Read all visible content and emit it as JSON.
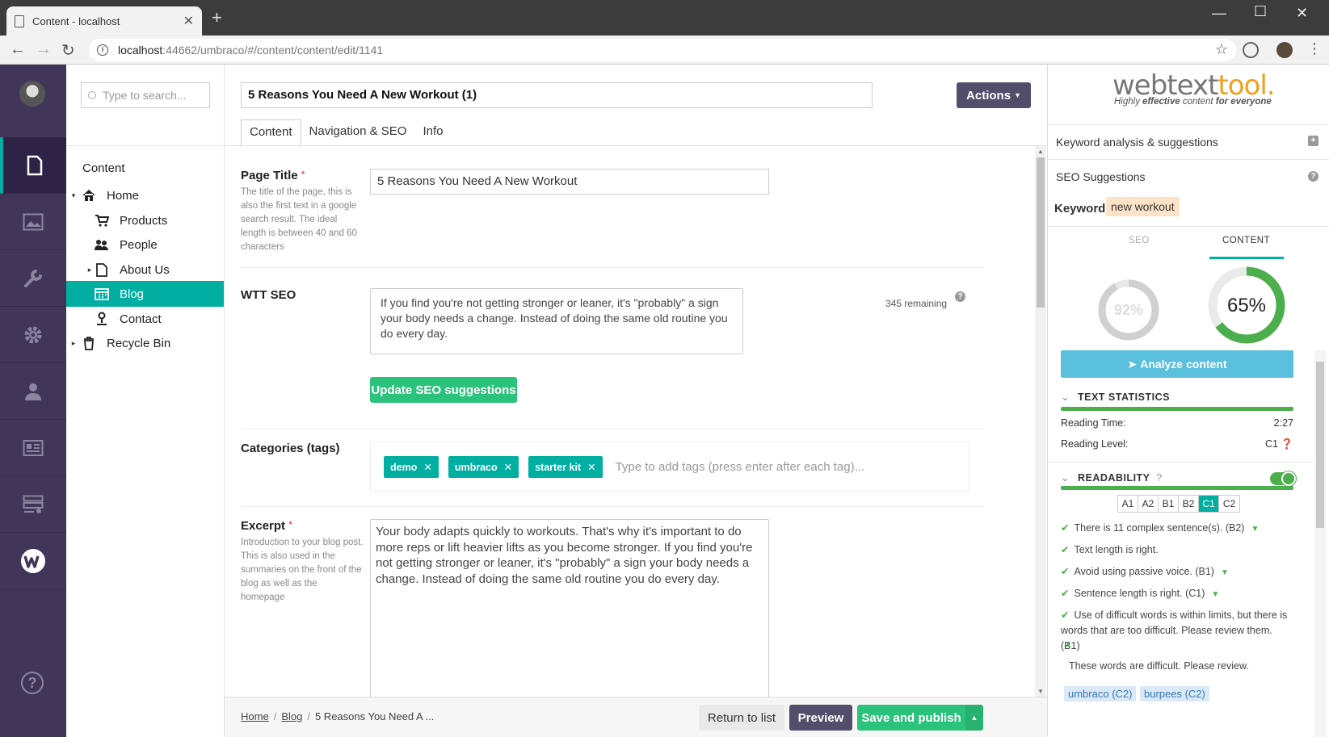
{
  "browser": {
    "tab_title": "Content - localhost",
    "url_host": "localhost",
    "url_path": ":44662/umbraco/#/content/content/edit/1141"
  },
  "rail": {
    "items": [
      {
        "name": "content",
        "icon": "document-icon",
        "active": true
      },
      {
        "name": "media",
        "icon": "image-icon"
      },
      {
        "name": "settings",
        "icon": "wrench-icon"
      },
      {
        "name": "developer",
        "icon": "gear-icon"
      },
      {
        "name": "users",
        "icon": "user-icon"
      },
      {
        "name": "members",
        "icon": "id-card-icon"
      },
      {
        "name": "forms",
        "icon": "form-icon"
      },
      {
        "name": "webtexttool",
        "icon": "webtexttool-w-icon"
      }
    ],
    "help_icon": "question-circle-icon"
  },
  "tree": {
    "search_placeholder": "Type to search...",
    "heading": "Content",
    "nodes": [
      {
        "label": "Home",
        "icon": "home-icon",
        "level": 0,
        "caret": "▾"
      },
      {
        "label": "Products",
        "icon": "cart-icon",
        "level": 1,
        "caret": ""
      },
      {
        "label": "People",
        "icon": "people-icon",
        "level": 1,
        "caret": ""
      },
      {
        "label": "About Us",
        "icon": "document-icon",
        "level": 1,
        "caret": "▸"
      },
      {
        "label": "Blog",
        "icon": "calendar-icon",
        "level": 1,
        "caret": "",
        "selected": true
      },
      {
        "label": "Contact",
        "icon": "map-pin-icon",
        "level": 1,
        "caret": ""
      },
      {
        "label": "Recycle Bin",
        "icon": "trash-icon",
        "level": 0,
        "caret": "▸"
      }
    ]
  },
  "editor": {
    "node_name": "5 Reasons You Need A New Workout (1)",
    "actions_label": "Actions",
    "tabs": [
      "Content",
      "Navigation & SEO",
      "Info"
    ],
    "page_title": {
      "label": "Page Title",
      "required": "*",
      "description": "The title of the page, this is also the first text in a google search result. The ideal length is between 40 and 60 characters",
      "value": "5 Reasons You Need A New Workout"
    },
    "wtt_seo": {
      "label": "WTT SEO",
      "value": "If you find you're not getting stronger or leaner, it's \"probably\" a sign your body needs a change. Instead of doing the same old routine you do every day.",
      "remaining": "345 remaining",
      "update_button": "Update SEO suggestions"
    },
    "categories": {
      "label": "Categories (tags)",
      "tags": [
        "demo",
        "umbraco",
        "starter kit"
      ],
      "placeholder": "Type to add tags (press enter after each tag)..."
    },
    "excerpt": {
      "label": "Excerpt",
      "required": "*",
      "description": "Introduction to your blog post. This is also used in the summaries on the front of the blog as well as the homepage",
      "value": "Your body adapts quickly to workouts. That's why it's important to do more reps or lift heavier lifts as you become stronger. If you find you're not getting stronger or leaner, it's \"probably\" a sign your body needs a change. Instead of doing the same old routine you do every day."
    }
  },
  "footer": {
    "breadcrumb": [
      "Home",
      "Blog",
      "5 Reasons You Need A ..."
    ],
    "return_label": "Return to list",
    "preview_label": "Preview",
    "save_label": "Save and publish"
  },
  "wtt": {
    "logo_main": "webtext",
    "logo_accent": "tool.",
    "tagline_pre": "Highly ",
    "tagline_em": "effective",
    "tagline_mid": " content ",
    "tagline_post": "for everyone",
    "keyword_analysis": "Keyword analysis & suggestions",
    "seo_suggestions": "SEO Suggestions",
    "keyword_label": "Keyword:",
    "keyword_value": "new workout",
    "tab_seo": "SEO",
    "tab_content": "CONTENT",
    "seo_score": "92%",
    "seo_score_value": 92,
    "content_score": "65%",
    "content_score_value": 65,
    "analyze_label": "Analyze content",
    "text_stats_title": "TEXT STATISTICS",
    "reading_time_label": "Reading Time:",
    "reading_time_value": "2:27",
    "reading_level_label": "Reading Level:",
    "reading_level_value": "C1",
    "readability_title": "READABILITY",
    "levels": [
      "A1",
      "A2",
      "B1",
      "B2",
      "C1",
      "C2"
    ],
    "active_level": "C1",
    "checks": [
      "There is 11 complex sentence(s). (B2)",
      "Text length is right.",
      "Avoid using passive voice. (B1)",
      "Sentence length is right. (C1)",
      "Use of difficult words is within limits, but there is words that are too difficult. Please review them. (B1)"
    ],
    "difficult_note": "These words are difficult. Please review.",
    "difficult_words": [
      "umbraco (C2)",
      "burpees (C2)"
    ],
    "colors": {
      "accent": "#00aea2",
      "green": "#4cae4c",
      "rail": "#413659"
    }
  }
}
